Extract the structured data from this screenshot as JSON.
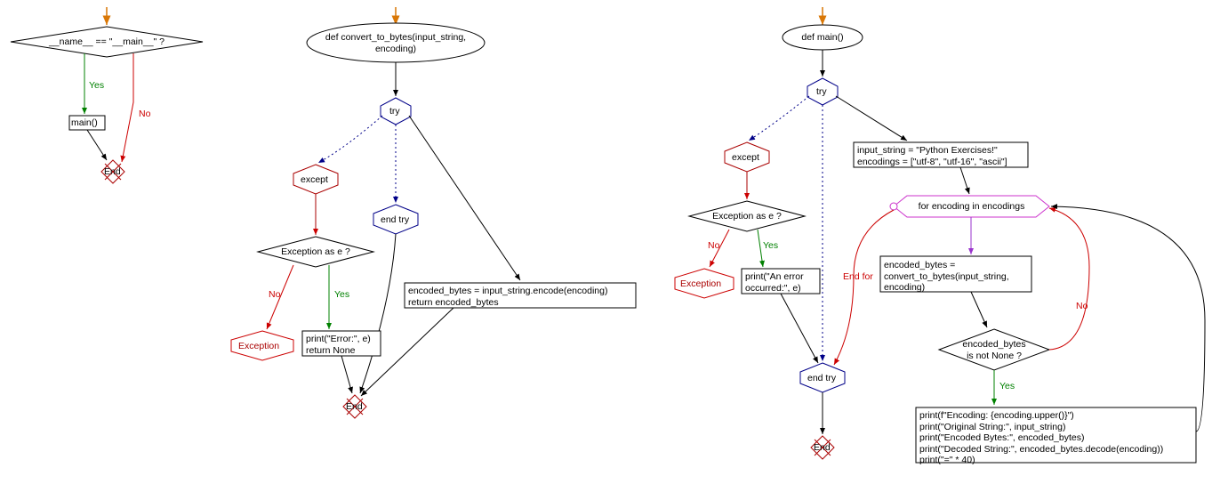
{
  "flowchart1": {
    "decision1": "__name__ == \"__main__\" ?",
    "yes": "Yes",
    "no": "No",
    "call": "main()",
    "end": "End"
  },
  "flowchart2": {
    "def": "def convert_to_bytes(input_string,\nencoding)",
    "try": "try",
    "except": "except",
    "endtry": "end try",
    "exc_check": "Exception as e ?",
    "yes": "Yes",
    "no": "No",
    "exception": "Exception",
    "print_err": "print(\"Error:\", e)\nreturn None",
    "body": "encoded_bytes = input_string.encode(encoding)\nreturn encoded_bytes",
    "end": "End"
  },
  "flowchart3": {
    "def": "def main()",
    "try": "try",
    "except": "except",
    "endtry": "end try",
    "exc_check": "Exception as e ?",
    "yes": "Yes",
    "no": "No",
    "exception": "Exception",
    "print_err": "print(\"An error\noccurred:\", e)",
    "init": "input_string = \"Python Exercises!\"\nencodings = [\"utf-8\", \"utf-16\", \"ascii\"]",
    "for": "for encoding in encodings",
    "endfor": "End for",
    "encode": "encoded_bytes =\nconvert_to_bytes(input_string,\nencoding)",
    "check": "encoded_bytes\nis not None ?",
    "prints": "print(f\"Encoding: {encoding.upper()}\")\nprint(\"Original String:\", input_string)\nprint(\"Encoded Bytes:\", encoded_bytes)\nprint(\"Decoded String:\", encoded_bytes.decode(encoding))\nprint(\"=\" * 40)",
    "end": "End"
  }
}
